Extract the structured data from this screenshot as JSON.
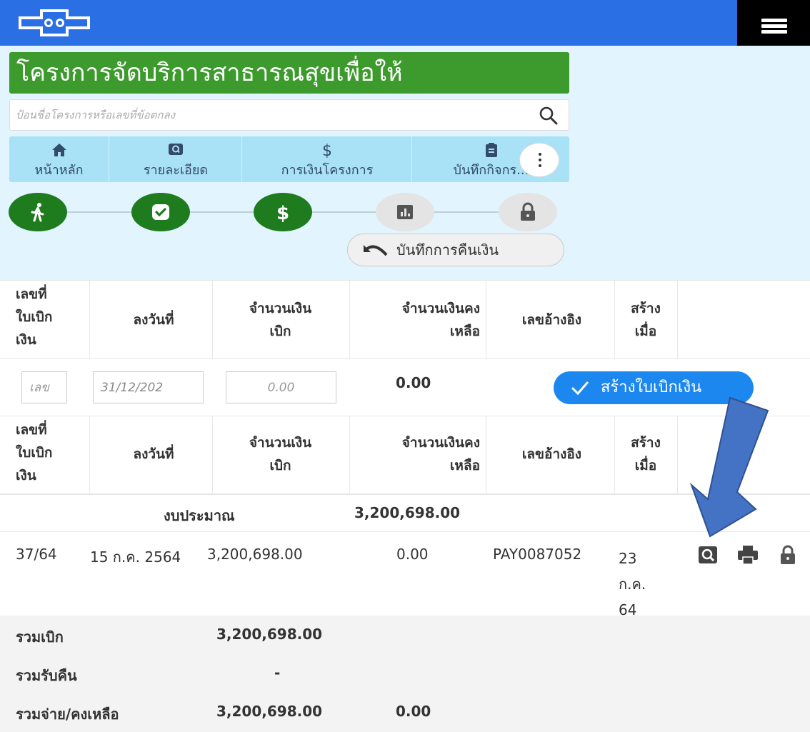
{
  "header": {
    "logo_icon": "health-cross-logo-icon",
    "menu_icon": "hamburger-icon",
    "brand_color": "#2a6fe4"
  },
  "project": {
    "title": "โครงการจัดบริการสาธารณสุขเพื่อให้",
    "title_color": "#3c9b2c"
  },
  "search": {
    "placeholder": "ป้อนชื่อโครงการหรือเลขที่ข้อตกลง",
    "icon": "search-icon"
  },
  "tabs": [
    {
      "label": "หน้าหลัก",
      "icon": "home-icon"
    },
    {
      "label": "รายละเอียด",
      "icon": "detail-search-icon"
    },
    {
      "label": "การเงินโครงการ",
      "icon": "dollar-icon"
    },
    {
      "label": "บันทึกกิจกร...",
      "icon": "clipboard-icon"
    }
  ],
  "more_icon": "more-vertical-icon",
  "steps": [
    {
      "icon": "walking-icon",
      "state": "done"
    },
    {
      "icon": "shield-check-icon",
      "state": "done"
    },
    {
      "icon": "dollar-icon",
      "state": "done"
    },
    {
      "icon": "bar-chart-icon",
      "state": "pending"
    },
    {
      "icon": "lock-icon",
      "state": "pending"
    }
  ],
  "refund_button": {
    "label": "บันทึกการคืนเงิน",
    "icon": "undo-icon"
  },
  "columns": {
    "doc_no": [
      "เลขที่",
      "ใบเบิก",
      "เงิน"
    ],
    "date": "ลงวันที่",
    "amount": [
      "จำนวนเงิน",
      "เบิก"
    ],
    "remaining": [
      "จำนวนเงินคง",
      "เหลือ"
    ],
    "ref": "เลขอ้างอิง",
    "created": [
      "สร้าง",
      "เมื่อ"
    ]
  },
  "form": {
    "doc_no_placeholder": "เลข",
    "date_value": "31/12/202",
    "amount_placeholder": "0.00",
    "remaining_value": "0.00",
    "create_button_label": "สร้างใบเบิกเงิน",
    "create_button_color": "#1d87f0"
  },
  "budget": {
    "label": "งบประมาณ",
    "value": "3,200,698.00"
  },
  "rows": [
    {
      "doc_no": "37/64",
      "date": "15 ก.ค. 2564",
      "amount": "3,200,698.00",
      "remaining": "0.00",
      "ref": "PAY0087052",
      "created": [
        "23",
        "ก.ค.",
        "64"
      ],
      "actions": [
        "view-icon",
        "print-icon",
        "lock-icon"
      ]
    }
  ],
  "summary": {
    "withdraw_label": "รวมเบิก",
    "withdraw_value": "3,200,698.00",
    "refund_label": "รวมรับคืน",
    "refund_value": "-",
    "paid_label": "รวมจ่าย/คงเหลือ",
    "paid_value": "3,200,698.00",
    "balance_value": "0.00"
  },
  "annotation": {
    "shape": "arrow-down-left",
    "color": "#4472c4"
  }
}
